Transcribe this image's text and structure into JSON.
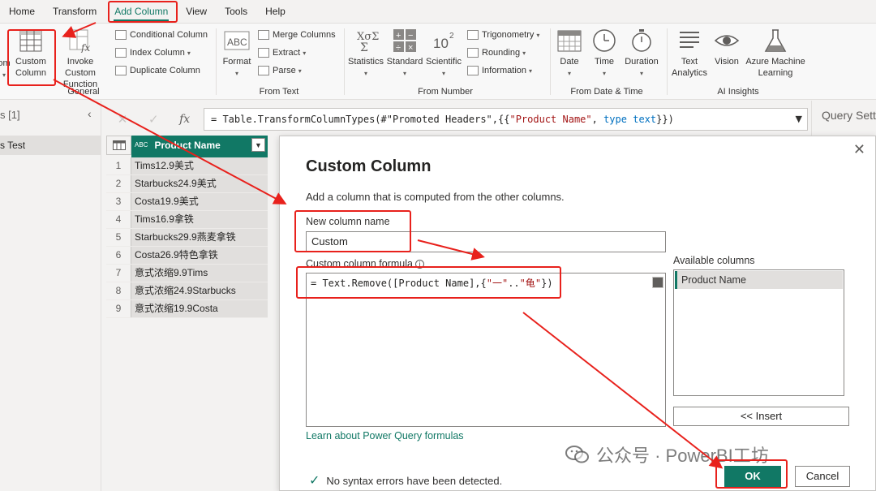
{
  "menu": {
    "items": [
      "Home",
      "Transform",
      "Add Column",
      "View",
      "Tools",
      "Help"
    ],
    "active": "Add Column"
  },
  "ribbon": {
    "general": {
      "label": "General",
      "custom_column": "Custom Column",
      "invoke_custom_function": "Invoke Custom Function",
      "custom_column_line1": "Custom",
      "custom_column_line2": "Column",
      "invoke_line1": "Invoke Custom",
      "invoke_line2": "Function",
      "conditional_column": "Conditional Column",
      "index_column": "Index Column",
      "duplicate_column": "Duplicate Column",
      "leftcut": "om"
    },
    "from_text": {
      "label": "From Text",
      "format": "Format",
      "merge_columns": "Merge Columns",
      "extract": "Extract",
      "parse": "Parse"
    },
    "from_number": {
      "label": "From Number",
      "statistics": "Statistics",
      "standard": "Standard",
      "scientific": "Scientific",
      "trigonometry": "Trigonometry",
      "rounding": "Rounding",
      "information": "Information"
    },
    "from_date_time": {
      "label": "From Date & Time",
      "date": "Date",
      "time": "Time",
      "duration": "Duration"
    },
    "ai_insights": {
      "label": "AI Insights",
      "text_analytics_1": "Text",
      "text_analytics_2": "Analytics",
      "vision": "Vision",
      "azure_ml_1": "Azure Machine",
      "azure_ml_2": "Learning"
    }
  },
  "left_pane": {
    "header": "s [1]",
    "item": "s Test"
  },
  "formula_bar": {
    "prefix": "= Table.TransformColumnTypes(#\"Promoted Headers\",{{",
    "string": "\"Product Name\"",
    "mid": ", ",
    "kw1": "type",
    "space": " ",
    "kw2": "text",
    "suffix": "}})",
    "fx": "fx"
  },
  "query_settings": {
    "title": "Query Settings"
  },
  "grid": {
    "type_icon": "ABC",
    "column": "Product Name",
    "rows": [
      {
        "n": "1",
        "v": "Tims12.9美式"
      },
      {
        "n": "2",
        "v": "Starbucks24.9美式"
      },
      {
        "n": "3",
        "v": "Costa19.9美式"
      },
      {
        "n": "4",
        "v": "Tims16.9拿铁"
      },
      {
        "n": "5",
        "v": "Starbucks29.9燕麦拿铁"
      },
      {
        "n": "6",
        "v": "Costa26.9特色拿铁"
      },
      {
        "n": "7",
        "v": "意式浓缩9.9Tims"
      },
      {
        "n": "8",
        "v": "意式浓缩24.9Starbucks"
      },
      {
        "n": "9",
        "v": "意式浓缩19.9Costa"
      }
    ]
  },
  "dialog": {
    "title": "Custom Column",
    "description": "Add a column that is computed from the other columns.",
    "new_column_label": "New column name",
    "new_column_value": "Custom",
    "formula_label": "Custom column formula",
    "formula_pre": "= Text.Remove([Product Name],{",
    "formula_s1": "\"一\"",
    "formula_mid": "..",
    "formula_s2": "\"龟\"",
    "formula_post": "})",
    "available_label": "Available columns",
    "available_items": [
      "Product Name"
    ],
    "insert_button": "<< Insert",
    "learn_link": "Learn about Power Query formulas",
    "syntax_status": "No syntax errors have been detected.",
    "ok_button": "OK",
    "cancel_button": "Cancel"
  },
  "watermark": {
    "text": "公众号 · PowerBI工坊"
  },
  "colors": {
    "accent": "#117865",
    "annotation": "#e8211c"
  }
}
